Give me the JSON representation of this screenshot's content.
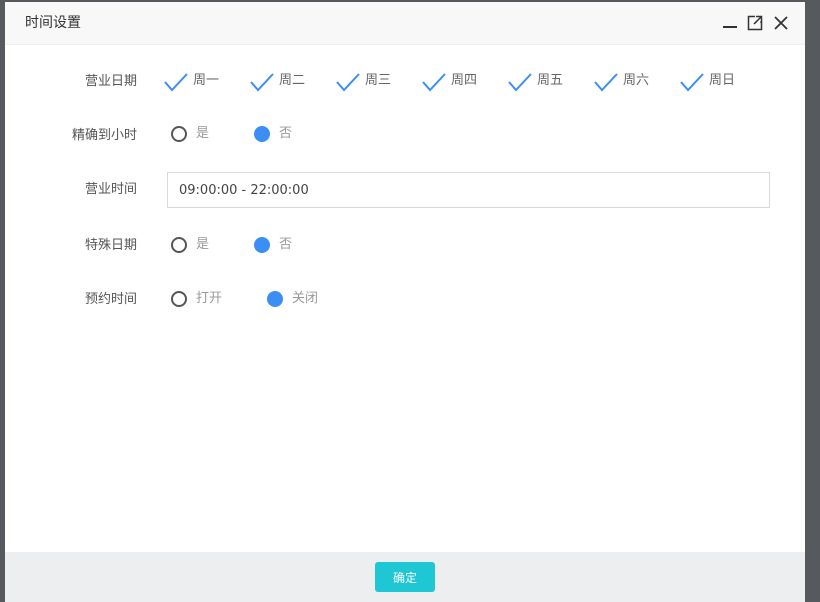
{
  "dialog": {
    "title": "时间设置",
    "controls": [
      "minimize-icon",
      "maximize-icon",
      "close-icon"
    ]
  },
  "form": {
    "business_days": {
      "label": "营业日期",
      "days": [
        {
          "label": "周一",
          "checked": true
        },
        {
          "label": "周二",
          "checked": true
        },
        {
          "label": "周三",
          "checked": true
        },
        {
          "label": "周四",
          "checked": true
        },
        {
          "label": "周五",
          "checked": true
        },
        {
          "label": "周六",
          "checked": true
        },
        {
          "label": "周日",
          "checked": true
        }
      ]
    },
    "precise_hour": {
      "label": "精确到小时",
      "options": [
        {
          "label": "是",
          "selected": false
        },
        {
          "label": "否",
          "selected": true
        }
      ]
    },
    "business_hours": {
      "label": "营业时间",
      "value": "09:00:00 - 22:00:00"
    },
    "special_dates": {
      "label": "特殊日期",
      "options": [
        {
          "label": "是",
          "selected": false
        },
        {
          "label": "否",
          "selected": true
        }
      ]
    },
    "booking_time": {
      "label": "预约时间",
      "options": [
        {
          "label": "打开",
          "selected": false
        },
        {
          "label": "关闭",
          "selected": true
        }
      ]
    }
  },
  "footer": {
    "confirm_label": "确定"
  },
  "colors": {
    "accent": "#3a8ef6",
    "confirm": "#1fc7d4",
    "check": "#3a8ef6"
  }
}
